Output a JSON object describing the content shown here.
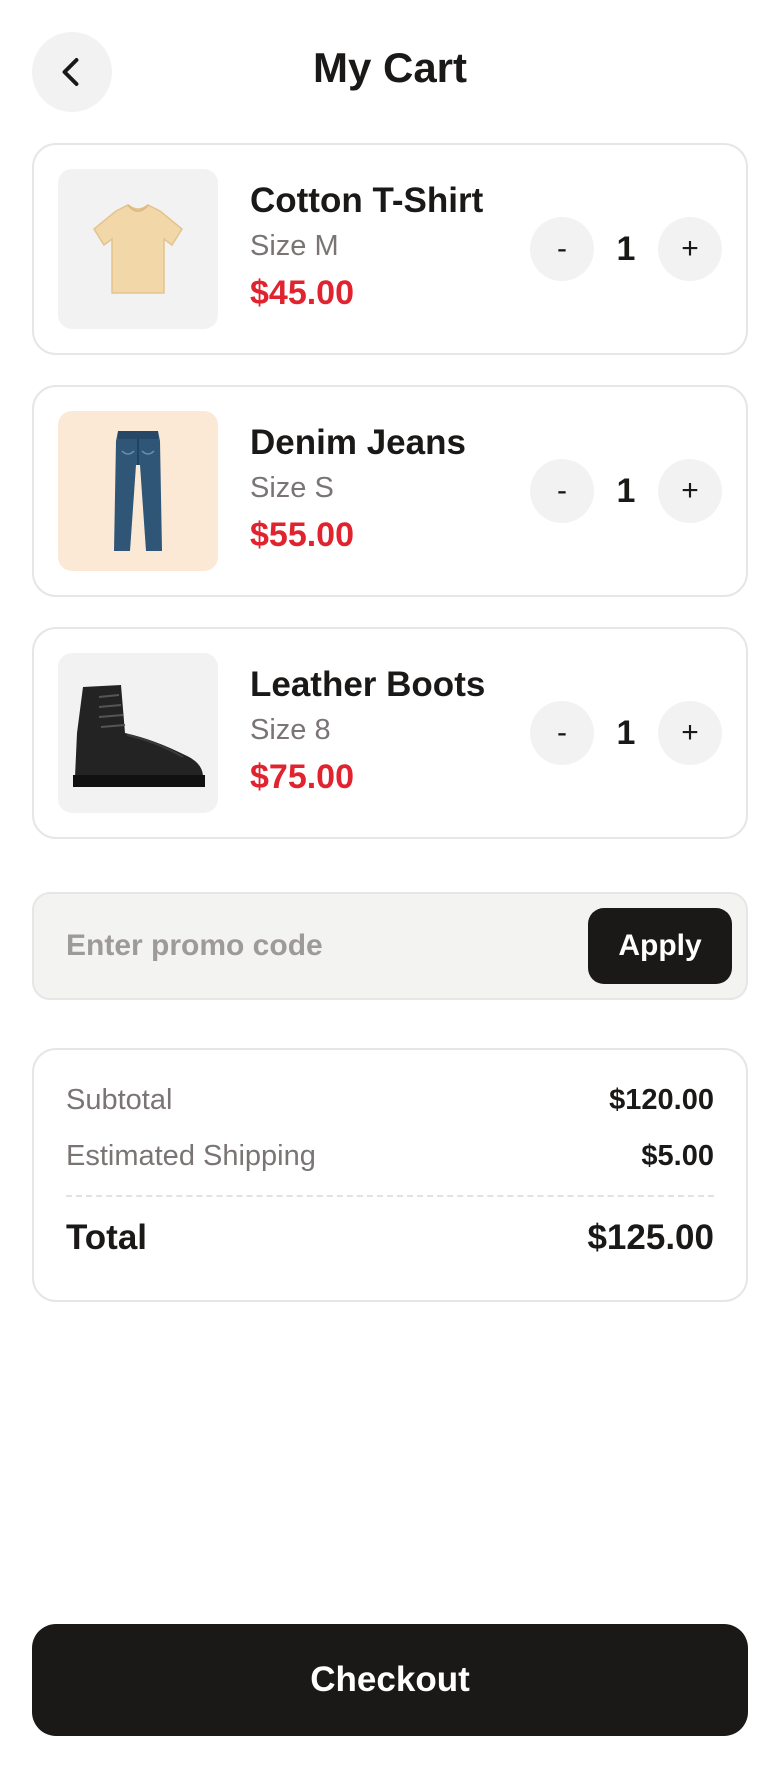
{
  "header": {
    "title": "My Cart",
    "back_icon": "chevron-left-icon"
  },
  "cart": {
    "items": [
      {
        "name": "Cotton T-Shirt",
        "size": "Size M",
        "price": "$45.00",
        "quantity": "1",
        "image": "t-shirt-image",
        "thumb_bg": "#f2f2f2"
      },
      {
        "name": "Denim Jeans",
        "size": "Size S",
        "price": "$55.00",
        "quantity": "1",
        "image": "jeans-image",
        "thumb_bg": "#fbe9d6"
      },
      {
        "name": "Leather Boots",
        "size": "Size 8",
        "price": "$75.00",
        "quantity": "1",
        "image": "boot-image",
        "thumb_bg": "#f2f2f2"
      }
    ],
    "decrement_label": "-",
    "increment_label": "+"
  },
  "promo": {
    "placeholder": "Enter promo code",
    "apply_label": "Apply"
  },
  "summary": {
    "subtotal_label": "Subtotal",
    "subtotal_value": "$120.00",
    "shipping_label": "Estimated Shipping",
    "shipping_value": "$5.00",
    "total_label": "Total",
    "total_value": "$125.00"
  },
  "checkout_label": "Checkout",
  "colors": {
    "accent_price": "#e0232e",
    "primary_dark": "#1b1918",
    "muted_text": "#7a7574",
    "control_bg": "#f2f2f2"
  }
}
